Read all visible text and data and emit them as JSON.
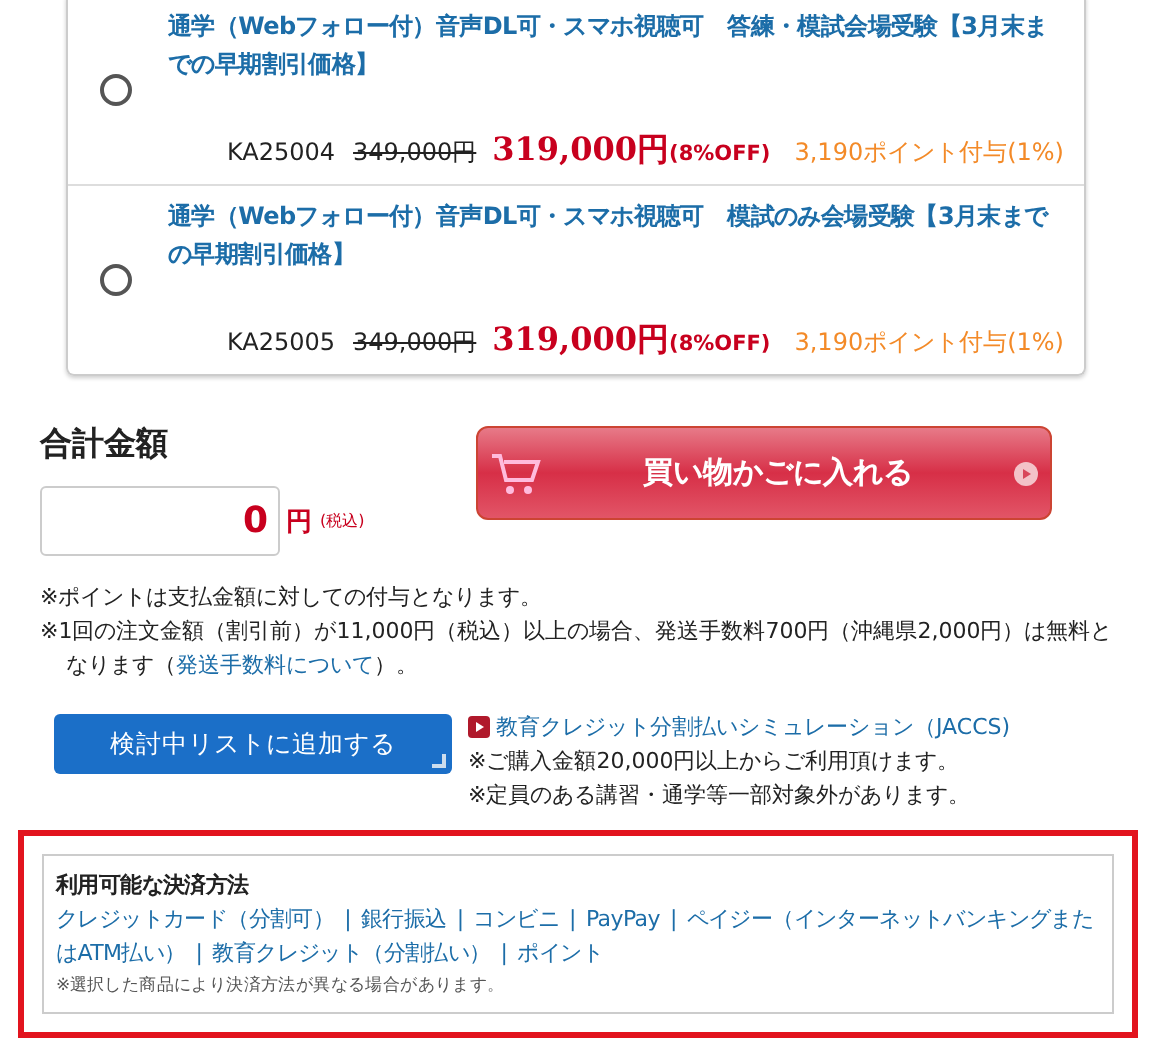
{
  "products": [
    {
      "title": "通学（Webフォロー付）音声DL可・スマホ視聴可　答練・模試会場受験【3月末までの早期割引価格】",
      "selected": false,
      "code": "KA25004",
      "list_price": "349,000円",
      "price": "319,000円",
      "discount": "(8%OFF)",
      "points": "3,190ポイント付与(1%)"
    },
    {
      "title": "通学（Webフォロー付）音声DL可・スマホ視聴可　模試のみ会場受験【3月末までの早期割引価格】",
      "selected": false,
      "code": "KA25005",
      "list_price": "349,000円",
      "price": "319,000円",
      "discount": "(8%OFF)",
      "points": "3,190ポイント付与(1%)"
    }
  ],
  "total": {
    "heading": "合計金額",
    "value": "0",
    "unit": "円",
    "tax_note": "(税込)"
  },
  "cart_button": "買い物かごに入れる",
  "notes": [
    "※ポイントは支払金額に対しての付与となります。"
  ],
  "shipping_note": {
    "text": "※1回の注文金額（割引前）が11,000円（税込）以上の場合、発送手数料700円（沖縄県2,000円）は無料となります（",
    "link": "発送手数料について",
    "end": "）。"
  },
  "wishlist_button": "検討中リストに追加する",
  "credit": {
    "link": "教育クレジット分割払いシミュレーション（JACCS)",
    "notes": [
      "※ご購入金額20,000円以上からご利用頂けます。",
      "※定員のある講習・通学等一部対象外があります。"
    ]
  },
  "payment": {
    "heading": "利用可能な決済方法",
    "separator": "|",
    "methods": [
      "クレジットカード（分割可）",
      "銀行振込",
      "コンビニ",
      "PayPay",
      "ペイジー（インターネットバンキングまたはATM払い）",
      "教育クレジット（分割払い）",
      "ポイント"
    ],
    "note": "※選択した商品により決済方法が異なる場合があります。"
  }
}
